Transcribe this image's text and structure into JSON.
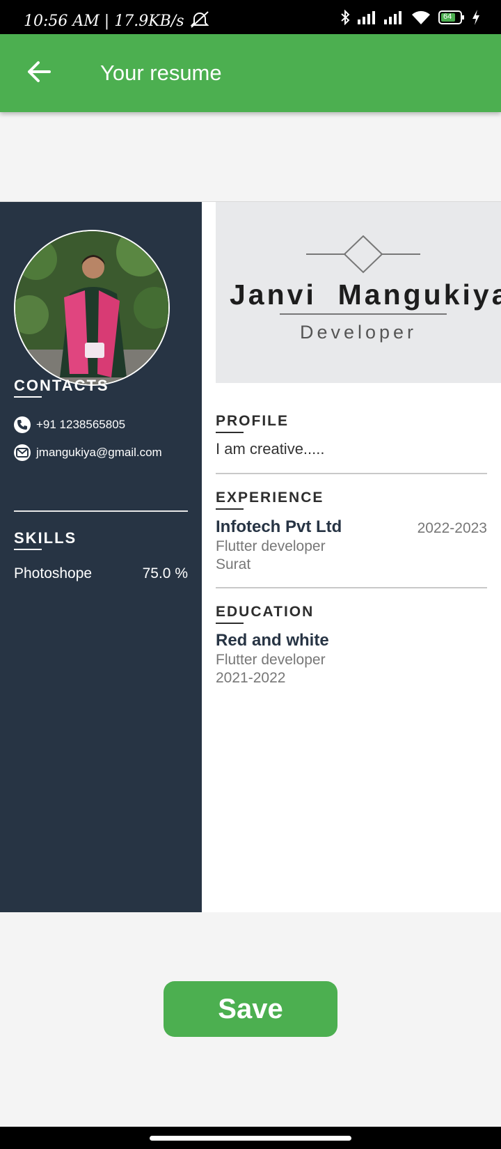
{
  "status_bar": {
    "time_and_speed": "10:56 AM | 17.9KB/s",
    "battery_level": "64"
  },
  "app_bar": {
    "title": "Your resume"
  },
  "resume": {
    "name": "Janvi  Mangukiya",
    "role": "Developer",
    "contacts": {
      "heading": "CONTACTS",
      "phone": "+91 1238565805",
      "email": "jmangukiya@gmail.com"
    },
    "skills": {
      "heading": "SKILLS",
      "items": [
        {
          "name": "Photoshope",
          "level": "75.0 %"
        }
      ]
    },
    "profile": {
      "heading": "PROFILE",
      "text": "I am creative....."
    },
    "experience": {
      "heading": "EXPERIENCE",
      "company": "Infotech Pvt Ltd",
      "dates": "2022-2023",
      "position": "Flutter developer",
      "location": "Surat"
    },
    "education": {
      "heading": "EDUCATION",
      "school": "Red and white",
      "course": "Flutter developer",
      "years": "2021-2022"
    }
  },
  "actions": {
    "save_label": "Save"
  },
  "colors": {
    "accent": "#4caf50",
    "sidebar": "#273444"
  }
}
